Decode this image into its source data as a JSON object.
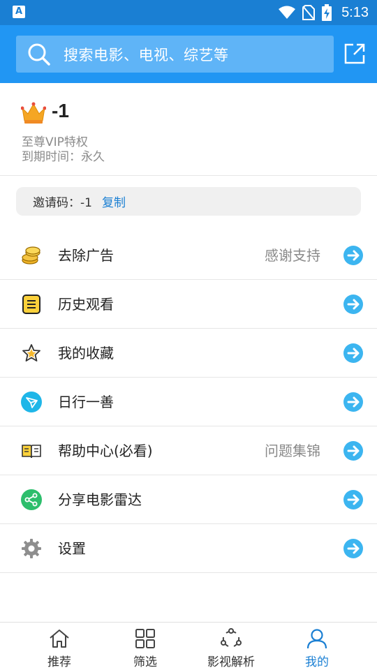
{
  "status_bar": {
    "time": "5:13",
    "left_icon_letter": "A"
  },
  "search": {
    "placeholder": "搜索电影、电视、综艺等"
  },
  "vip": {
    "name": "-1",
    "title": "至尊VIP特权",
    "expiry": "到期时间：永久"
  },
  "invite": {
    "label": "邀请码：-1",
    "copy_label": "复制"
  },
  "menu": [
    {
      "label": "去除广告",
      "hint": "感谢支持",
      "icon": "coins-icon"
    },
    {
      "label": "历史观看",
      "hint": "",
      "icon": "history-icon"
    },
    {
      "label": "我的收藏",
      "hint": "",
      "icon": "star-icon"
    },
    {
      "label": "日行一善",
      "hint": "",
      "icon": "paper-plane-icon"
    },
    {
      "label": "帮助中心(必看)",
      "hint": "问题集锦",
      "icon": "book-icon"
    },
    {
      "label": "分享电影雷达",
      "hint": "",
      "icon": "share-icon"
    },
    {
      "label": "设置",
      "hint": "",
      "icon": "gear-icon"
    }
  ],
  "tabs": [
    {
      "label": "推荐",
      "icon": "home-icon"
    },
    {
      "label": "筛选",
      "icon": "grid-icon"
    },
    {
      "label": "影视解析",
      "icon": "parse-icon"
    },
    {
      "label": "我的",
      "icon": "user-icon"
    }
  ],
  "colors": {
    "primary": "#2196f3",
    "status_bar": "#1a7fd3",
    "accent": "#1a7fd3",
    "arrow": "#3cb5f0"
  }
}
